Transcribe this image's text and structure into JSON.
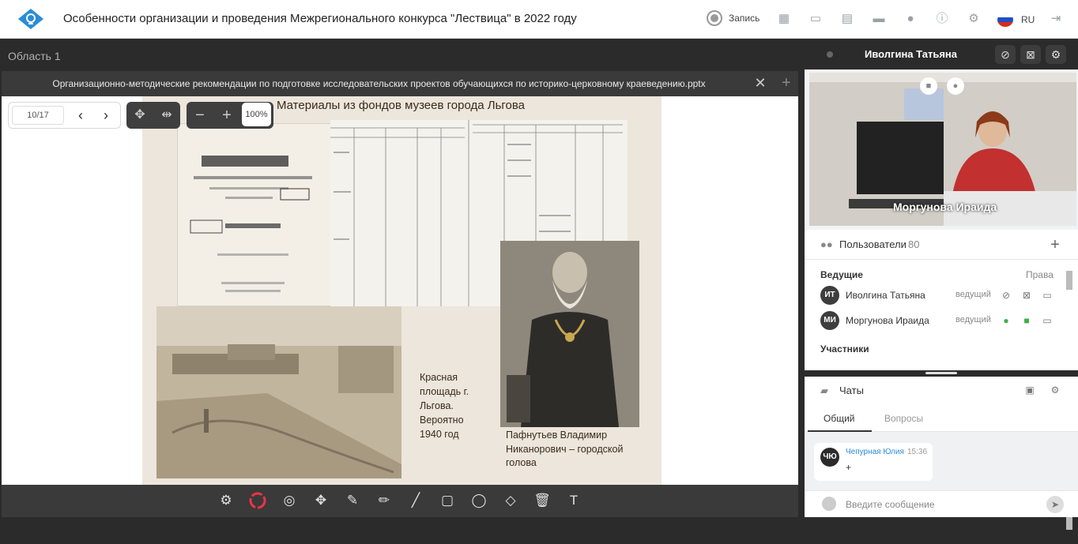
{
  "app": {
    "title": "Особенности организации и проведения Межрегионального конкурса \"Лествица\" в 2022 году",
    "record_label": "Запись",
    "language": "RU"
  },
  "workspace": {
    "area_label": "Область 1",
    "document_title": "Организационно-методические рекомендации по подготовке исследовательских проектов обучающихся по историко-церковному краеведению.pptx",
    "page_input": "10/17",
    "zoom": "100%"
  },
  "slide": {
    "heading": "Материалы  из фондов музеев города Льгова",
    "caption_square": "Красная площадь г. Льгова. Вероятно 1940 год",
    "caption_portrait": "Пафнутьев  Владимир Никанорович – городской голова"
  },
  "video": {
    "host_name": "Иволгина Татьяна",
    "speaker_label": "Моргунова Ираида"
  },
  "users": {
    "title": "Пользователи",
    "count": "80",
    "section_hosts": "Ведущие",
    "rights_label": "Права",
    "section_participants": "Участники",
    "hosts": [
      {
        "initials": "ИТ",
        "name": "Иволгина Татьяна",
        "role": "ведущий"
      },
      {
        "initials": "МИ",
        "name": "Моргунова Ираида",
        "role": "ведущий"
      }
    ]
  },
  "chats": {
    "title": "Чаты",
    "tabs": [
      "Общий",
      "Вопросы"
    ],
    "messages": [
      {
        "initials": "ЧЮ",
        "author": "Чепурная Юлия",
        "time": "15:36",
        "text": "+"
      }
    ],
    "input_placeholder": "Введите сообщение"
  },
  "colors": {
    "accent": "#2a8cd8",
    "mic_on": "#3cb043",
    "dark": "#2b2b2b"
  }
}
